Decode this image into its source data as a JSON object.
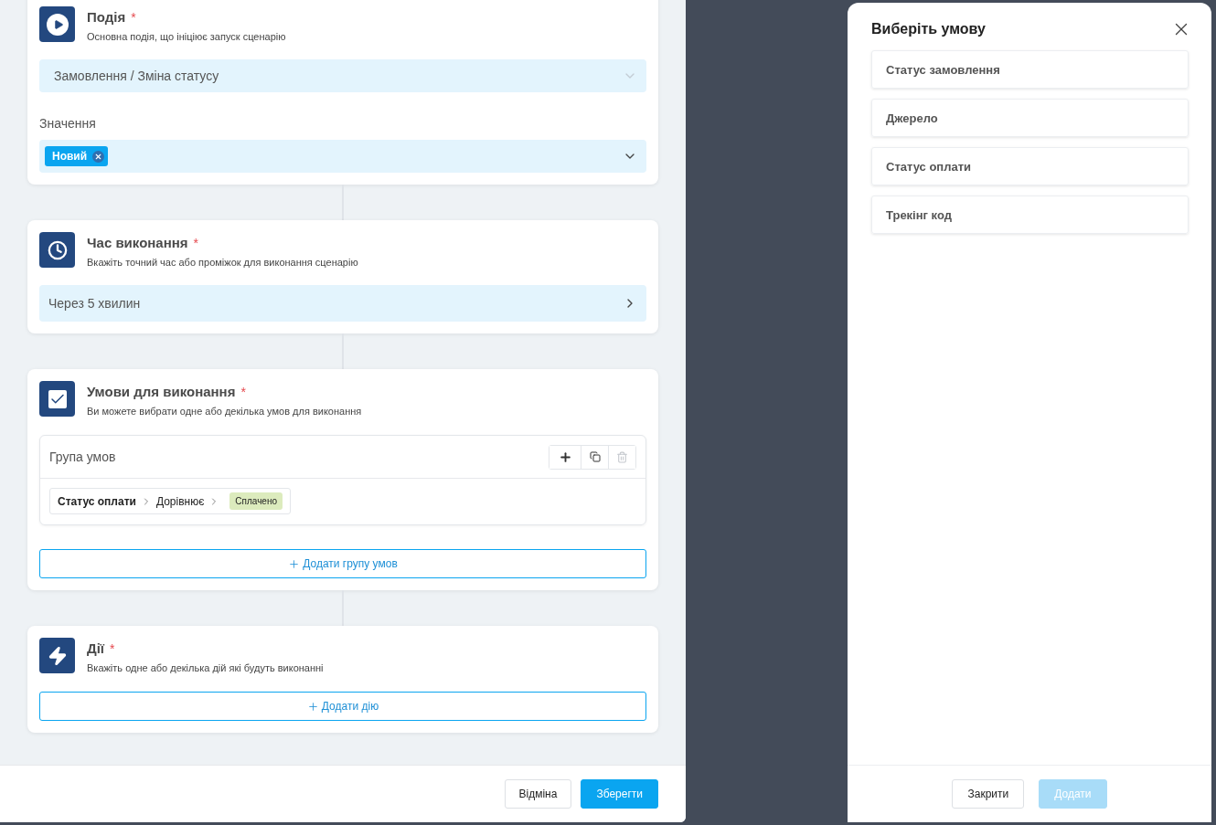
{
  "editor": {
    "sections": [
      {
        "kind": "event",
        "title": "Подія",
        "required_mark": "*",
        "subtitle": "Основна подія, що ініціює запуск сценарію",
        "select": {
          "value": "Замовлення / Зміна статусу"
        },
        "values_label": "Значення",
        "tags": [
          {
            "label": "Новий"
          }
        ]
      },
      {
        "kind": "time",
        "title": "Час виконання",
        "required_mark": "*",
        "subtitle": "Вкажіть точний час або проміжок для виконання сценарію",
        "select": {
          "value": "Через 5 хвилин"
        }
      },
      {
        "kind": "conditions",
        "title": "Умови для виконання",
        "required_mark": "*",
        "subtitle": "Ви можете вибрати одне або декілька умов для виконання",
        "groups": [
          {
            "title": "Група умов",
            "tools": [
              {
                "kind": "add",
                "disabled": false
              },
              {
                "kind": "copy",
                "disabled": false
              },
              {
                "kind": "delete",
                "disabled": true
              }
            ],
            "conditions": [
              {
                "field": "Статус оплати",
                "operator": "Дорівнює",
                "value": "Сплачено",
                "color": "#dcebbd"
              }
            ]
          }
        ],
        "add_label": "Додати групу умов"
      },
      {
        "kind": "actions",
        "title": "Дії",
        "required_mark": "*",
        "subtitle": "Вкажіть одне або декілька дій які будуть виконанні",
        "add_label": "Додати дію"
      }
    ]
  },
  "footer": {
    "buttons": [
      {
        "label": "Відміна",
        "kind": "secondary",
        "disabled": false
      },
      {
        "label": "Зберегти",
        "kind": "primary",
        "disabled": false
      }
    ]
  },
  "drawer": {
    "title": "Виберіть умову",
    "options": [
      {
        "label": "Статус замовлення"
      },
      {
        "label": "Джерело"
      },
      {
        "label": "Статус оплати"
      },
      {
        "label": "Трекінг код"
      }
    ],
    "buttons": [
      {
        "label": "Закрити",
        "kind": "secondary",
        "disabled": false
      },
      {
        "label": "Додати",
        "kind": "primary",
        "disabled": true
      }
    ]
  }
}
